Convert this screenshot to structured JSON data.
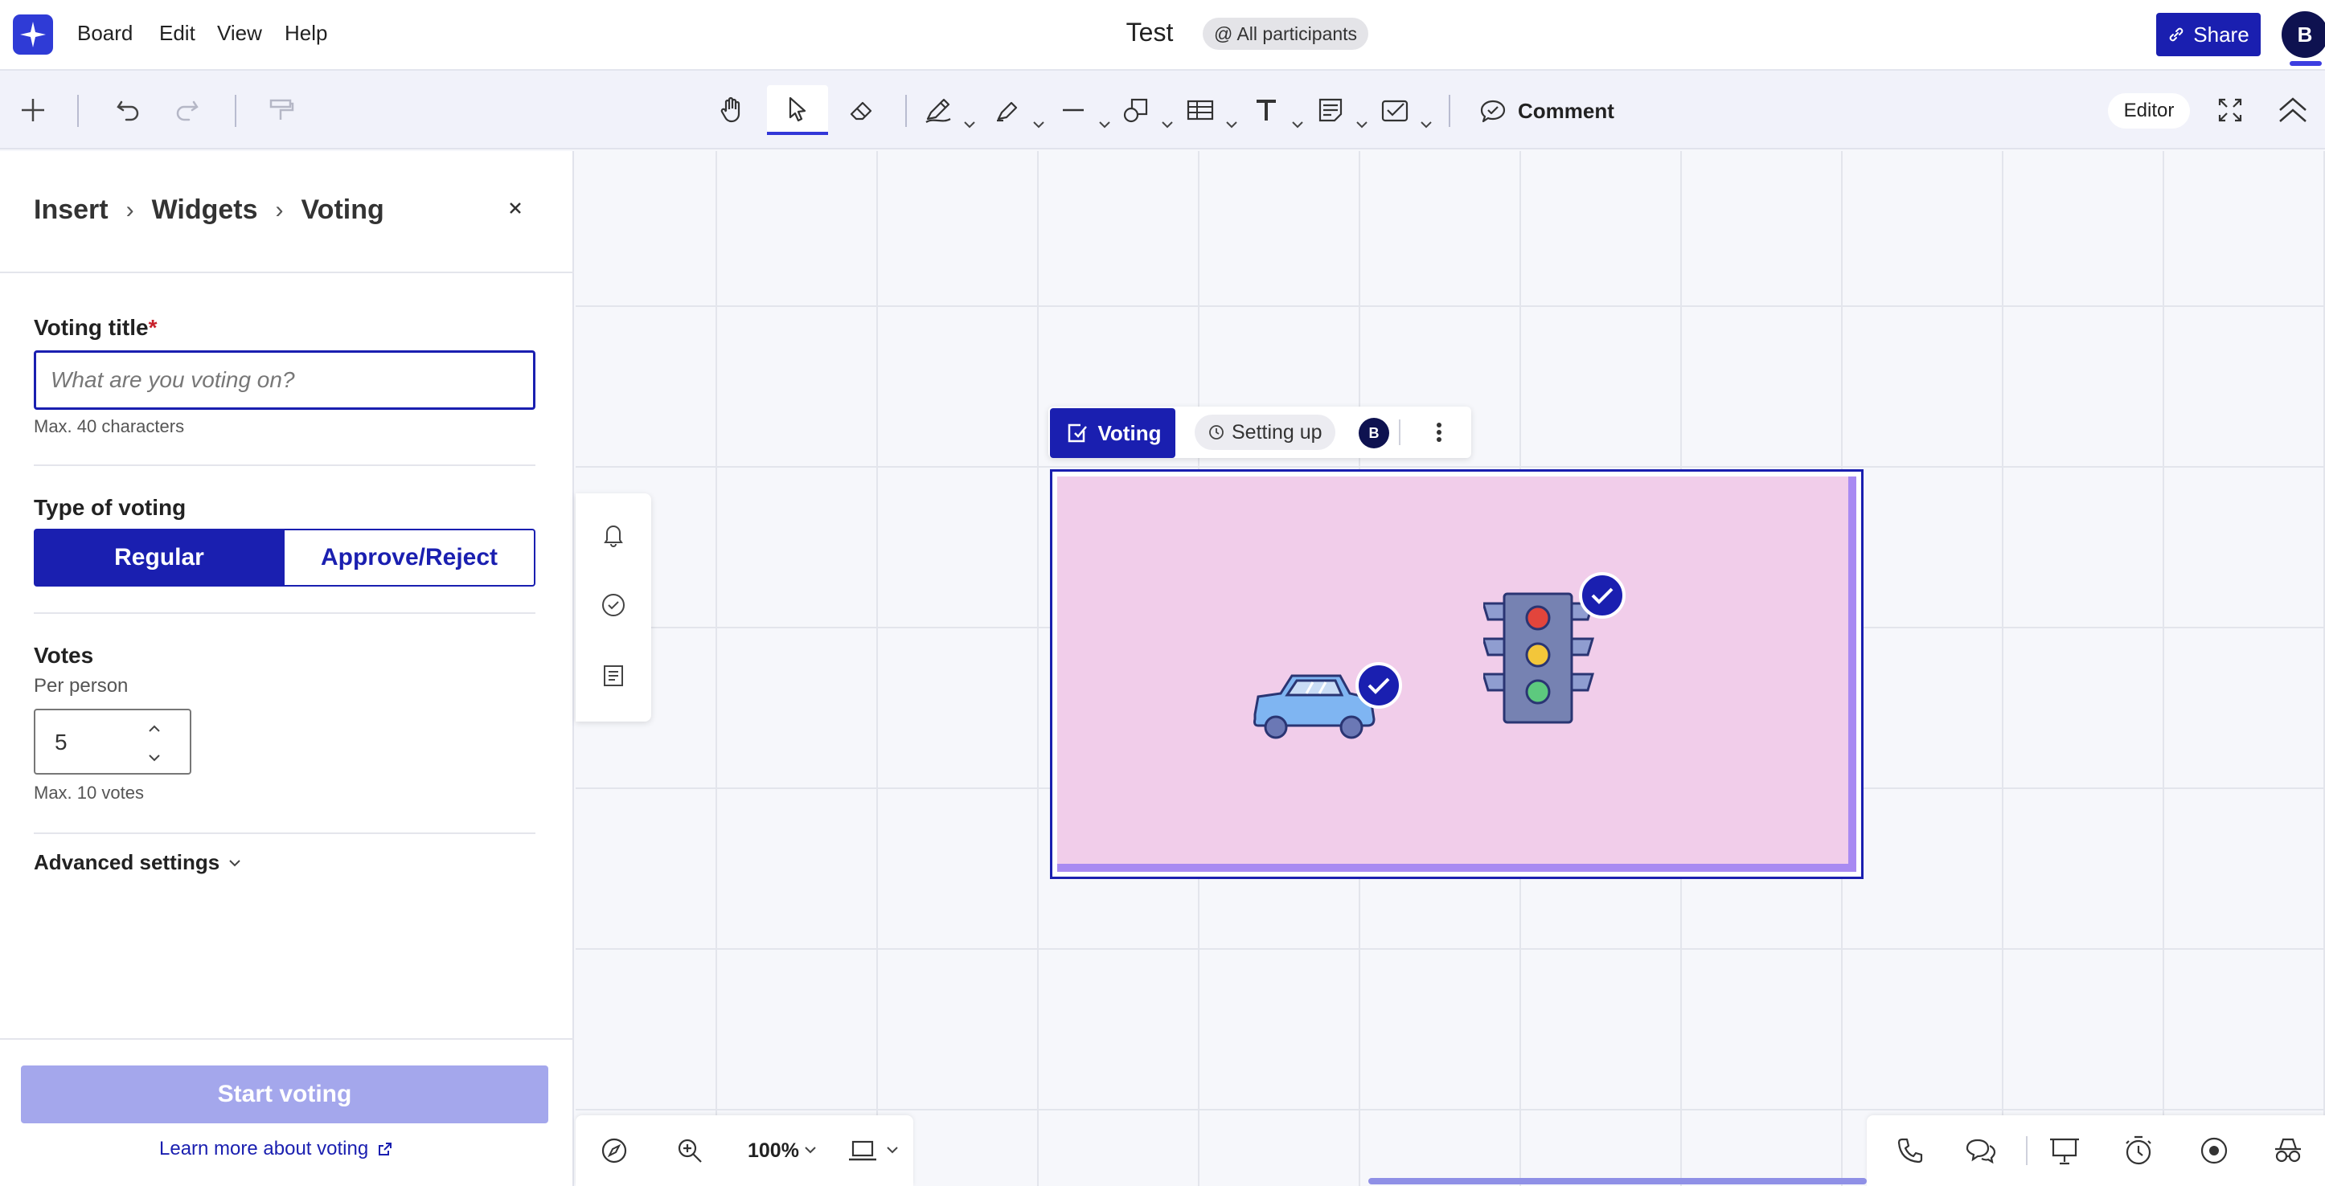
{
  "app": {
    "menu": [
      "Board",
      "Edit",
      "View",
      "Help"
    ],
    "doc_title": "Test",
    "participants": "@ All participants",
    "share_label": "Share",
    "avatar_initial": "B"
  },
  "toolbar": {
    "comment_label": "Comment",
    "mode_label": "Editor"
  },
  "panel": {
    "breadcrumb": [
      "Insert",
      "Widgets",
      "Voting"
    ],
    "voting_title_label": "Voting title",
    "required_mark": "*",
    "voting_title_placeholder": "What are you voting on?",
    "voting_title_value": "",
    "max_chars_hint": "Max. 40 characters",
    "type_label": "Type of voting",
    "type_options": [
      "Regular",
      "Approve/Reject"
    ],
    "type_selected": "Regular",
    "votes_label": "Votes",
    "per_person_label": "Per person",
    "votes_value": "5",
    "max_votes_hint": "Max. 10 votes",
    "advanced_label": "Advanced settings",
    "start_label": "Start voting",
    "learn_more_label": "Learn more about voting"
  },
  "widget": {
    "voting_label": "Voting",
    "status_label": "Setting up",
    "avatar_initial": "B",
    "colors": {
      "area": "#f1cdea",
      "frame": "#1a1fb0",
      "accent": "#a88af2"
    }
  },
  "zoom": {
    "level": "100%"
  },
  "icons": {
    "toolbar": [
      "plus-icon",
      "undo-icon",
      "redo-icon",
      "format-painter-icon",
      "hand-icon",
      "pointer-icon",
      "eraser-icon",
      "pen-icon",
      "highlighter-icon",
      "line-icon",
      "shapes-icon",
      "table-icon",
      "text-icon",
      "sticky-note-icon",
      "checklist-icon",
      "comment-icon",
      "fullscreen-icon",
      "collapse-icon"
    ],
    "bottom_right": [
      "phone-icon",
      "chat-icon",
      "presentation-icon",
      "timer-icon",
      "record-icon",
      "incognito-icon"
    ]
  }
}
